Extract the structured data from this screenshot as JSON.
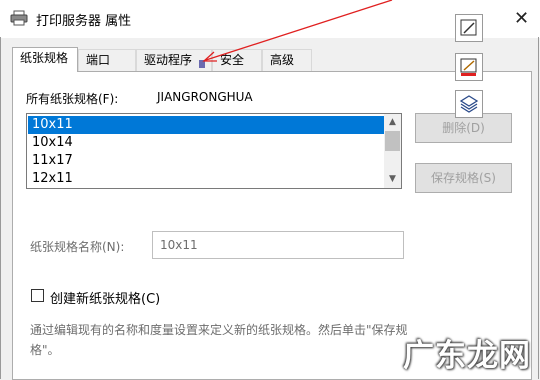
{
  "window": {
    "title": "打印服务器 属性",
    "close_glyph": "✕"
  },
  "tabs": [
    {
      "label": "纸张规格",
      "active": true
    },
    {
      "label": "端口",
      "active": false
    },
    {
      "label": "驱动程序",
      "active": false
    },
    {
      "label": "安全",
      "active": false
    },
    {
      "label": "高级",
      "active": false
    }
  ],
  "forms": {
    "all_label": "所有纸张规格(F):",
    "server_name": "JIANGRONGHUA",
    "list": [
      "10x11",
      "10x14",
      "11x17",
      "12x11"
    ],
    "selected_index": 0,
    "delete_label": "删除(D)",
    "save_label": "保存规格(S)",
    "name_label": "纸张规格名称(N):",
    "name_value": "10x11",
    "create_new_label": "创建新纸张规格(C)",
    "create_new_checked": false,
    "description": "通过编辑现有的名称和度量设置来定义新的纸张规格。然后单击\"保存规格\"。"
  },
  "annotation_tools": [
    "edit-pen-icon",
    "color-pen-icon",
    "layers-icon"
  ],
  "watermark": "广东龙网",
  "colors": {
    "selection": "#0078d7",
    "annotation_arrow": "#e02020"
  }
}
